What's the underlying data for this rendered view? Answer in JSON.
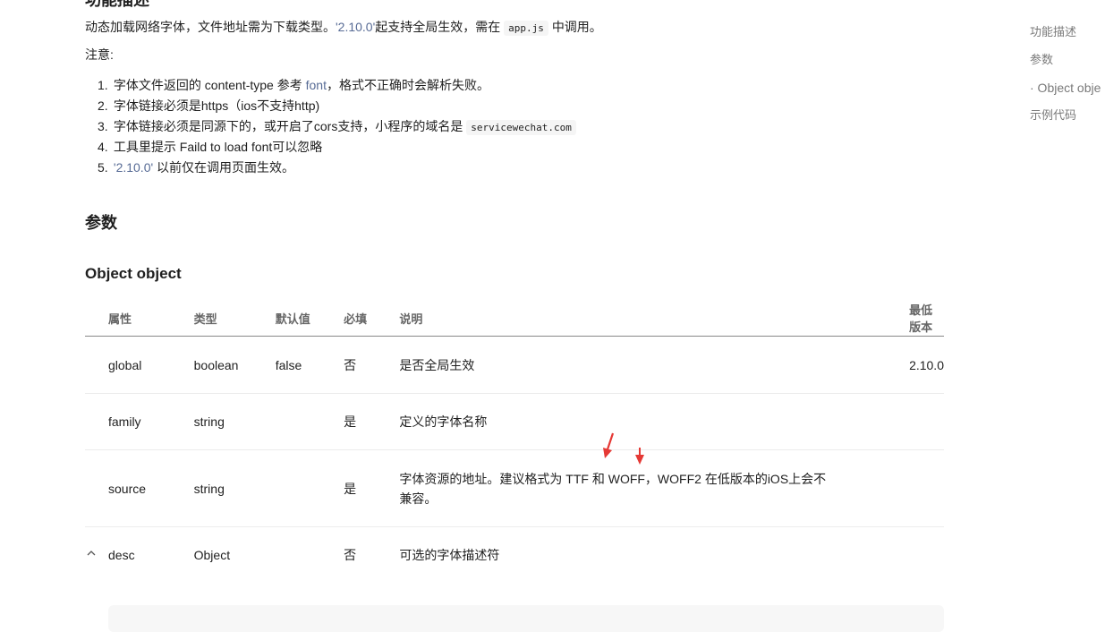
{
  "top_heading": "功能描述",
  "intro": {
    "before": "动态加载网络字体，文件地址需为下载类型。",
    "version_link": "'2.10.0'",
    "middle": "起支持全局生效，需在",
    "code": "app.js",
    "after": "中调用。"
  },
  "note_label": "注意:",
  "notes": [
    {
      "num": "1.",
      "before": "字体文件返回的 content-type 参考 ",
      "link": "font",
      "after": "，格式不正确时会解析失败。"
    },
    {
      "num": "2.",
      "text": "字体链接必须是https（ios不支持http)"
    },
    {
      "num": "3.",
      "before": "字体链接必须是同源下的，或开启了cors支持，小程序的域名是 ",
      "code": "servicewechat.com"
    },
    {
      "num": "4.",
      "text": "工具里提示 Faild to load font可以忽略"
    },
    {
      "num": "5.",
      "link": "'2.10.0'",
      "after": " 以前仅在调用页面生效。"
    }
  ],
  "section_title": "参数",
  "subsection_title": "Object object",
  "table": {
    "headers": [
      "属性",
      "类型",
      "默认值",
      "必填",
      "说明",
      "最低版本"
    ],
    "rows": [
      {
        "name": "global",
        "type": "boolean",
        "default": "false",
        "required": "否",
        "desc": "是否全局生效",
        "version": "2.10.0"
      },
      {
        "name": "family",
        "type": "string",
        "default": "",
        "required": "是",
        "desc": "定义的字体名称",
        "version": ""
      },
      {
        "name": "source",
        "type": "string",
        "default": "",
        "required": "是",
        "desc": "字体资源的地址。建议格式为 TTF 和 WOFF，WOFF2 在低版本的iOS上会不兼容。",
        "version": ""
      },
      {
        "name": "desc",
        "type": "Object",
        "default": "",
        "required": "否",
        "desc": "可选的字体描述符",
        "version": ""
      }
    ]
  },
  "toc": {
    "items": [
      "功能描述",
      "参数",
      "· Object obje",
      "示例代码"
    ]
  },
  "annotation_color": "#e53935",
  "link_color": "#576b95"
}
